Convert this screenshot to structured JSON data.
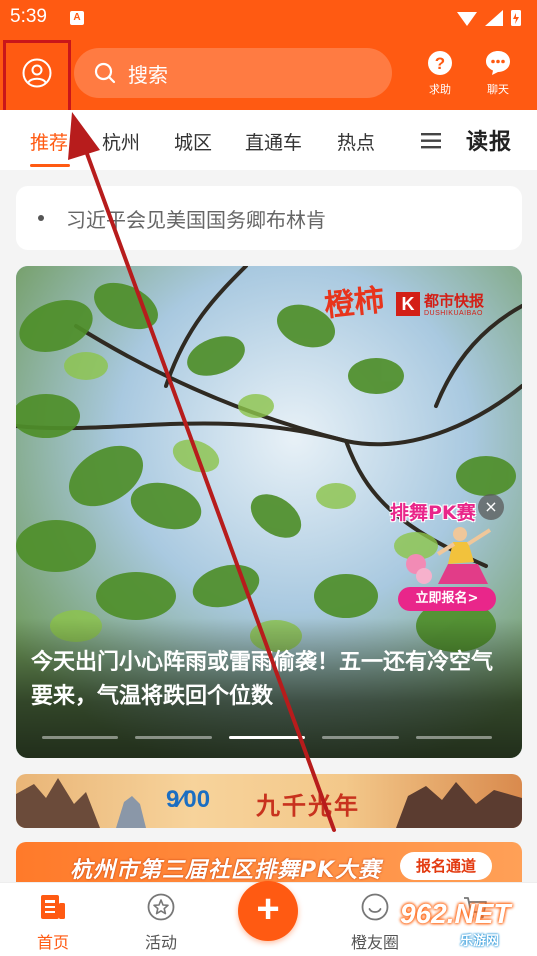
{
  "status_bar": {
    "time": "5:39",
    "notification_badge": "A"
  },
  "header": {
    "search_placeholder": "搜索",
    "help_label": "求助",
    "chat_label": "聊天",
    "accent_color": "#ff5a12"
  },
  "tabs": {
    "items": [
      "推荐",
      "杭州",
      "城区",
      "直通车",
      "热点"
    ],
    "active_index": 0,
    "brand_tab": "读报"
  },
  "headline": {
    "text": "习近平会见美国国务卿布林肯"
  },
  "hero": {
    "title": "今天出门小心阵雨或雷雨偷袭！五一还有冷空气要来，气温将跌回个位数",
    "brand_script": "橙柿",
    "brand_name": "都市快报",
    "brand_pinyin": "DUSHIKUAIBAO",
    "promo_title": "排舞PK赛",
    "promo_button": "立即报名>",
    "carousel_count": 5,
    "carousel_active": 2
  },
  "banner1": {
    "logo_text": "9⁄00",
    "title": "九千光年"
  },
  "banner2": {
    "title": "杭州市第三届社区排舞PK大赛",
    "button": "报名通道"
  },
  "bottom_nav": {
    "home": "首页",
    "activity": "活动",
    "friends": "橙友圈",
    "cart": ""
  },
  "watermark": {
    "number": "962.NET",
    "subtitle": "乐游网"
  }
}
